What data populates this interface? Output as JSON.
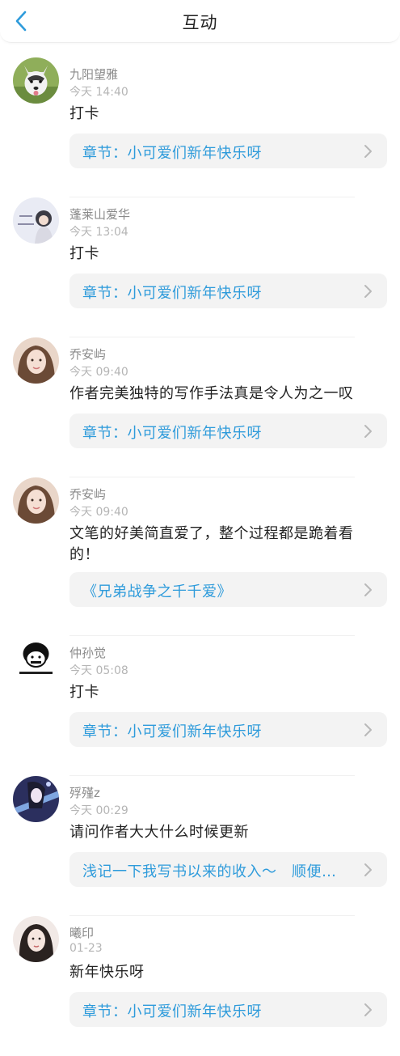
{
  "header": {
    "title": "互动",
    "back_icon": "chevron-left-icon"
  },
  "accent_color": "#2e9bdb",
  "comments": [
    {
      "name": "九阳望雅",
      "time": "今天 14:40",
      "text": "打卡",
      "ref": "章节：小可爱们新年快乐呀"
    },
    {
      "name": "蓬莱山爱华",
      "time": "今天 13:04",
      "text": "打卡",
      "ref": "章节：小可爱们新年快乐呀"
    },
    {
      "name": "乔安屿",
      "time": "今天 09:40",
      "text": "作者完美独特的写作手法真是令人为之一叹",
      "ref": "章节：小可爱们新年快乐呀"
    },
    {
      "name": "乔安屿",
      "time": "今天 09:40",
      "text": "文笔的好美简直爱了，整个过程都是跪着看的！",
      "ref": "《兄弟战争之千千爱》"
    },
    {
      "name": "仲孙觉",
      "time": "今天 05:08",
      "text": "打卡",
      "ref": "章节：小可爱们新年快乐呀"
    },
    {
      "name": "殍殣z",
      "time": "今天 00:29",
      "text": "请问作者大大什么时候更新",
      "ref": "浅记一下我写书以来的收入～　顺便…"
    },
    {
      "name": "曦印",
      "time": "01-23",
      "text": "新年快乐呀",
      "ref": "章节：小可爱们新年快乐呀"
    }
  ]
}
